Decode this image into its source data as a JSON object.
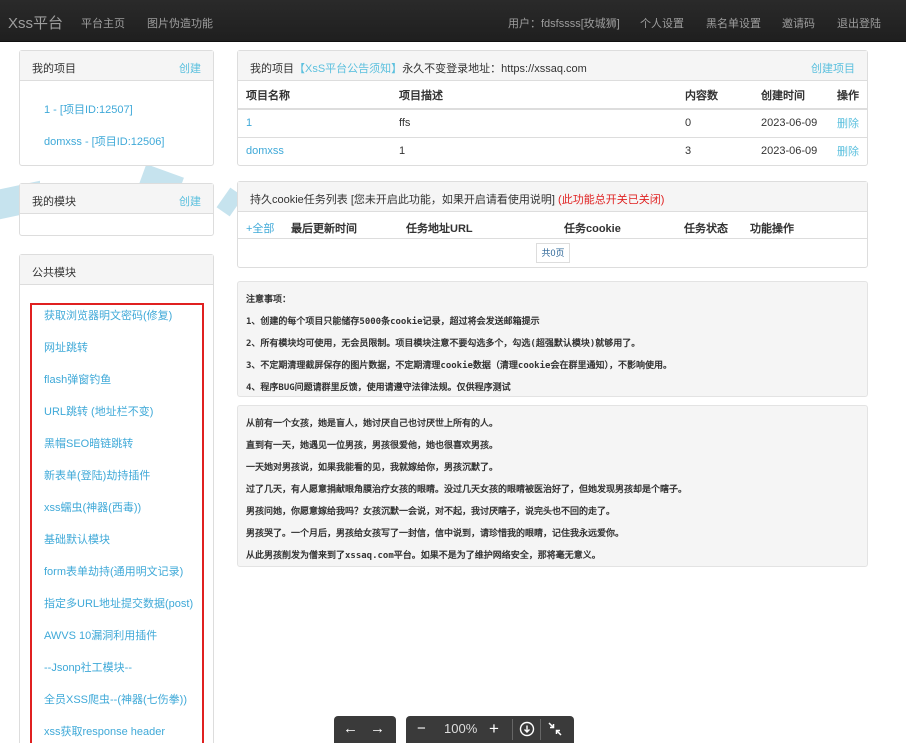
{
  "nav": {
    "brand": "Xss平台",
    "links": [
      "平台主页",
      "图片伪造功能"
    ],
    "user": "用户：fdsfssss[玫城狮]",
    "right_links": [
      "个人设置",
      "黑名单设置",
      "邀请码",
      "退出登陆"
    ]
  },
  "my_projects": {
    "title": "我的项目",
    "create": "创建",
    "items": [
      "1 - [项目ID:12507]",
      "domxss - [项目ID:12506]"
    ]
  },
  "my_modules": {
    "title": "我的模块",
    "create": "创建"
  },
  "public_modules": {
    "title": "公共模块",
    "items": [
      "获取浏览器明文密码(修复)",
      "网址跳转",
      "flash弹窗钓鱼",
      "URL跳转 (地址栏不变)",
      "黑帽SEO暗链跳转",
      "新表单(登陆)劫持插件",
      "xss蠕虫(神器(西毒))",
      "基础默认模块",
      "form表单劫持(通用明文记录)",
      "指定多URL地址提交数据(post)",
      "AWVS 10漏洞利用插件",
      "--Jsonp社工模块--",
      "全员XSS爬虫--(神器(七伤拳))",
      "xss获取response header"
    ]
  },
  "projects_panel": {
    "title_prefix": "我的项目",
    "notice_link": "【XsS平台公告须知】",
    "title_suffix": "永久不变登录地址：https://xssaq.com",
    "create": "创建项目",
    "columns": [
      "项目名称",
      "项目描述",
      "内容数",
      "创建时间",
      "操作"
    ],
    "rows": [
      {
        "name": "1",
        "desc": "ffs",
        "count": "0",
        "date": "2023-06-09",
        "action": "删除"
      },
      {
        "name": "domxss",
        "desc": "1",
        "count": "3",
        "date": "2023-06-09",
        "action": "删除"
      }
    ]
  },
  "cookie_panel": {
    "title": "持久cookie任务列表 [您未开启此功能，如果开启请看使用说明]",
    "warning": "(此功能总开关已关闭)",
    "all": "+全部",
    "columns": [
      "最后更新时间",
      "任务地址URL",
      "任务cookie",
      "任务状态",
      "功能操作"
    ],
    "pager": "共0页"
  },
  "notes": [
    "注意事项：",
    "1、创建的每个项目只能储存5000条cookie记录，超过将会发送邮箱提示",
    "2、所有模块均可使用，无会员限制。项目模块注意不要勾选多个，勾选(超强默认模块)就够用了。",
    "3、不定期清理截屏保存的图片数据，不定期清理cookie数据（清理cookie会在群里通知），不影响使用。",
    "4、程序BUG问题请群里反馈，使用请遵守法律法规。仅供程序测试"
  ],
  "story": [
    "从前有一个女孩，她是盲人，她讨厌自己也讨厌世上所有的人。",
    "直到有一天，她遇见一位男孩，男孩很爱他，她也很喜欢男孩。",
    "一天她对男孩说，如果我能看的见，我就嫁给你，男孩沉默了。",
    "过了几天，有人愿意捐献眼角膜治疗女孩的眼睛。没过几天女孩的眼睛被医治好了，但她发现男孩却是个瞎子。",
    "男孩问她，你愿意嫁给我吗？女孩沉默一会说，对不起，我讨厌瞎子，说完头也不回的走了。",
    "男孩哭了。一个月后，男孩给女孩写了一封信，信中说到，请珍惜我的眼睛，记住我永远爱你。",
    "从此男孩削发为僧来到了xssaq.com平台。如果不是为了维护网络安全，那将毫无意义。"
  ],
  "viewer_toolbar": {
    "prev": "←",
    "next": "→",
    "zoom_out": "−",
    "zoom": "100%",
    "zoom_in": "+",
    "download_icon": "download-icon",
    "collapse_icon": "collapse-icon"
  }
}
